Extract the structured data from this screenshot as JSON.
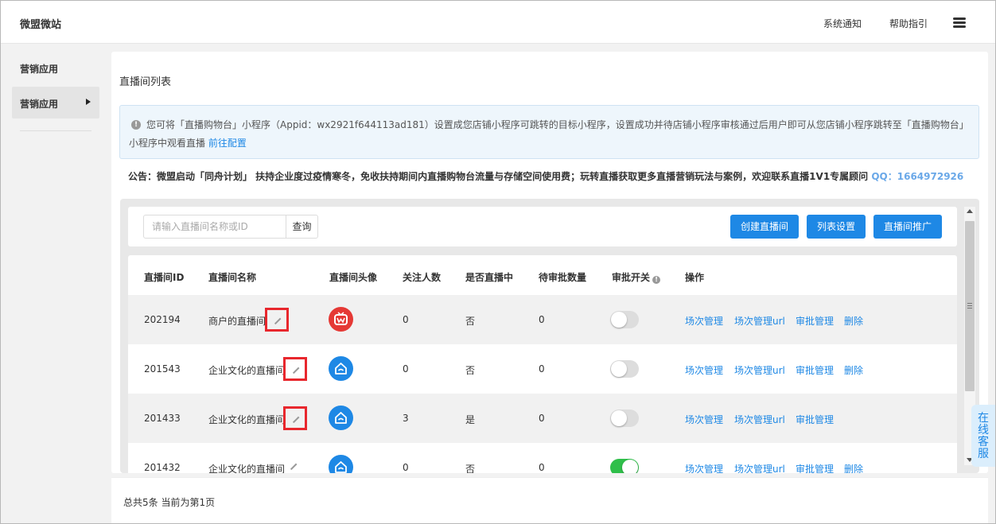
{
  "header": {
    "brand": "微盟微站",
    "links": [
      "系统通知",
      "帮助指引"
    ]
  },
  "sidebar": {
    "group_label": "营销应用",
    "active_item": "营销应用"
  },
  "main": {
    "title": "直播间列表",
    "notice": {
      "line1": "您可将「直播购物台」小程序（Appid：wx2921f644113ad181）设置成您店铺小程序可跳转的目标小程序，设置成功并待店铺小程序审核通过后用户即可从您店铺小程序跳转至「直播购物台」",
      "line2_prefix": "小程序中观看直播",
      "line2_link": "前往配置"
    },
    "announcement": {
      "text": "公告：微盟启动「同舟计划」 扶持企业度过疫情寒冬，免收扶持期间内直播购物台流量与存储空间使用费；玩转直播获取更多直播营销玩法与案例，欢迎联系直播1V1专属顾问 ",
      "qq": "QQ：1664972926"
    },
    "search": {
      "placeholder": "请输入直播间名称或ID",
      "value": "",
      "button": "查询"
    },
    "actions": [
      "创建直播间",
      "列表设置",
      "直播间推广"
    ],
    "table": {
      "columns": [
        "直播间ID",
        "直播间名称",
        "直播间头像",
        "关注人数",
        "是否直播中",
        "待审批数量",
        "审批开关",
        "操作"
      ],
      "rows": [
        {
          "id": "202194",
          "name": "商户的直播间",
          "followers": "0",
          "live": "否",
          "pending": "0",
          "approval_on": false,
          "ops": [
            "场次管理",
            "场次管理url",
            "审批管理",
            "删除"
          ]
        },
        {
          "id": "201543",
          "name": "企业文化的直播间",
          "followers": "0",
          "live": "否",
          "pending": "0",
          "approval_on": false,
          "ops": [
            "场次管理",
            "场次管理url",
            "审批管理",
            "删除"
          ]
        },
        {
          "id": "201433",
          "name": "企业文化的直播间",
          "followers": "3",
          "live": "是",
          "pending": "0",
          "approval_on": false,
          "ops": [
            "场次管理",
            "场次管理url",
            "审批管理"
          ]
        },
        {
          "id": "201432",
          "name": "企业文化的直播间",
          "followers": "0",
          "live": "否",
          "pending": "0",
          "approval_on": true,
          "ops": [
            "场次管理",
            "场次管理url",
            "审批管理",
            "删除"
          ]
        }
      ]
    }
  },
  "footer": {
    "summary": "总共5条 当前为第1页"
  },
  "service_tab": {
    "label": "在线客服"
  },
  "colors": {
    "accent": "#1e88e5",
    "highlight_box": "#e8272d",
    "toggle_on": "#2fbf4a"
  }
}
